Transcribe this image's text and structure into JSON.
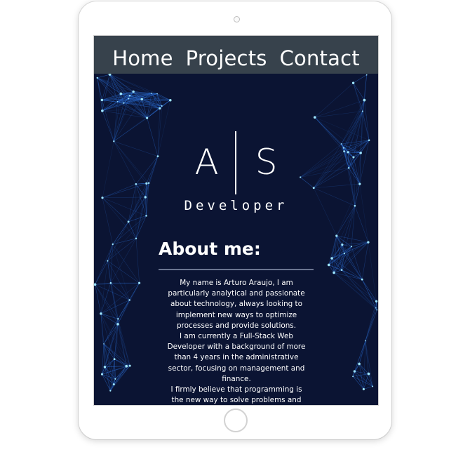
{
  "nav": {
    "items": [
      "Home",
      "Projects",
      "Contact"
    ]
  },
  "logo": {
    "left_letter": "A",
    "right_letter": "S",
    "subtitle": "Developer"
  },
  "about": {
    "title": "About me:",
    "paragraphs": [
      "My name is Arturo Araujo, I am particularly analytical and passionate about technology, always looking to implement new ways to optimize processes and provide solutions.",
      "I am currently a Full-Stack Web Developer with a background of more than 4 years in the administrative sector, focusing on management and finance.",
      "I firmly believe that programming is the new way to solve problems and automate processes and for this reason I"
    ]
  },
  "colors": {
    "background": "#0b1433",
    "navbar": "#37424c",
    "network_lines": "#2c6fd6",
    "network_nodes": "#9fe6ff"
  }
}
